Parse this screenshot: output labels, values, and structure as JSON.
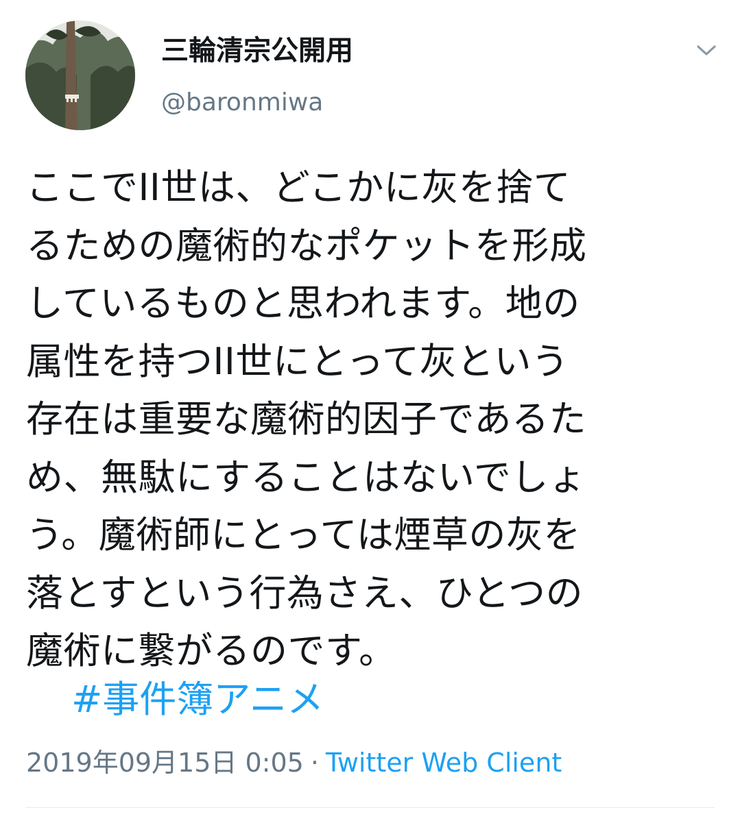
{
  "tweet": {
    "display_name": "三輪清宗公開用",
    "handle": "@baronmiwa",
    "body_lines": [
      "ここでII世は、どこかに灰を捨て",
      "るための魔術的なポケットを形成",
      "しているものと思われます。地の",
      "属性を持つII世にとって灰という",
      "存在は重要な魔術的因子であるた",
      "め、無駄にすることはないでしょ",
      "う。魔術師にとっては煙草の灰を",
      "落とすという行為さえ、ひとつの",
      "魔術に繋がるのです。"
    ],
    "hashtag": "#事件簿アニメ",
    "timestamp": "2019年09月15日 0:05",
    "separator": "·",
    "source": "Twitter Web Client"
  },
  "icons": {
    "caret": "chevron-down-icon",
    "avatar": "avatar-image"
  },
  "colors": {
    "text": "#14171a",
    "secondary": "#657786",
    "accent": "#1da1f2",
    "divider": "#e6ecf0"
  }
}
